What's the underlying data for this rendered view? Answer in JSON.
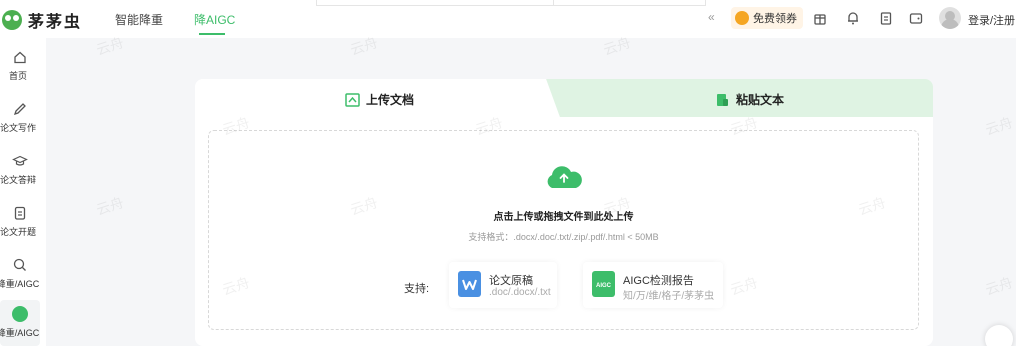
{
  "brand": {
    "logo_text": "茅茅虫",
    "accent": "#3dbd6a"
  },
  "nav": {
    "tabs": [
      {
        "label": "智能降重"
      },
      {
        "label": "降AIGC"
      }
    ],
    "coupon": "免费领券",
    "login": "登录/注册"
  },
  "sidebar": {
    "items": [
      {
        "label": "首页",
        "icon": "home-icon"
      },
      {
        "label": "论文写作",
        "icon": "pen-icon"
      },
      {
        "label": "论文答辩",
        "icon": "graduation-cap-icon"
      },
      {
        "label": "论文开题",
        "icon": "clipboard-icon"
      },
      {
        "label": "降重/AIGC",
        "icon": "search-icon"
      },
      {
        "label": "降重/AIGC",
        "icon": "leaf-icon"
      }
    ]
  },
  "card": {
    "tab_upload": "上传文档",
    "tab_paste": "粘贴文本",
    "drop_title": "点击上传或拖拽文件到此处上传",
    "drop_formats": "支持格式：.docx/.doc/.txt/.zip/.pdf/.html < 50MB",
    "support_label": "支持:",
    "support_items": [
      {
        "title": "论文原稿",
        "sub": ".doc/.docx/.txt",
        "color": "#4a90e2"
      },
      {
        "title": "AIGC检测报告",
        "sub": "知/万/维/格子/茅茅虫",
        "color": "#3dbd6a"
      }
    ]
  },
  "watermark": "云舟"
}
